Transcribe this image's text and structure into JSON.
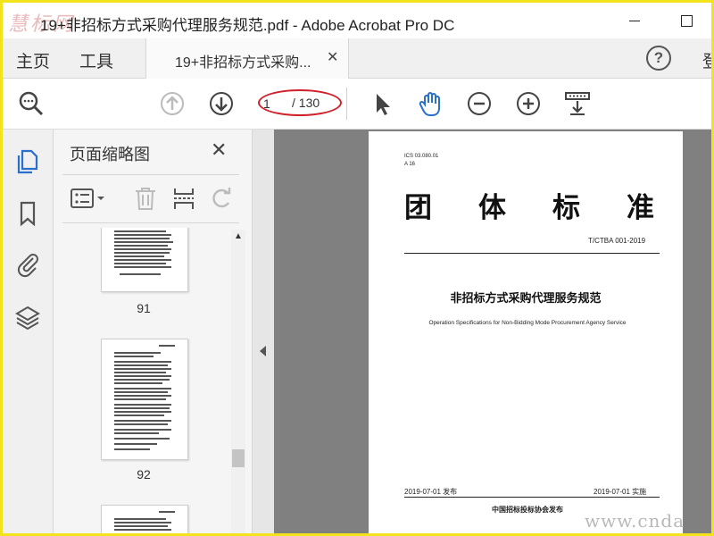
{
  "window": {
    "title": "19+非招标方式采购代理服务规范.pdf - Adobe Acrobat Pro DC",
    "watermark_logo": "慧 标 网",
    "watermark_url": "www.cnda"
  },
  "tabbar": {
    "home_label": "主页",
    "tools_label": "工具",
    "doc_tab_label": "19+非招标方式采购...",
    "signin_label": "登"
  },
  "toolbar": {
    "page_current": "1",
    "page_total": "/ 130"
  },
  "thumb_panel": {
    "title": "页面缩略图",
    "thumbnails": [
      {
        "page": "91"
      },
      {
        "page": "92"
      }
    ]
  },
  "document": {
    "ics": "ICS 03.080.01",
    "ccs": "A 16",
    "title_chars": [
      "团",
      "体",
      "标",
      "准"
    ],
    "code": "T/CTBA 001-2019",
    "name": "非招标方式采购代理服务规范",
    "english_name": "Operation Specifications for Non-Bidding Mode Procurement Agency Service",
    "release_date": "2019-07-01 发布",
    "implement_date": "2019-07-01 实施",
    "publisher": "中国招标投标协会发布"
  },
  "colors": {
    "accent": "#2a6fc9",
    "annotation_red": "#d0202a",
    "frame_yellow": "#f2e31c"
  }
}
